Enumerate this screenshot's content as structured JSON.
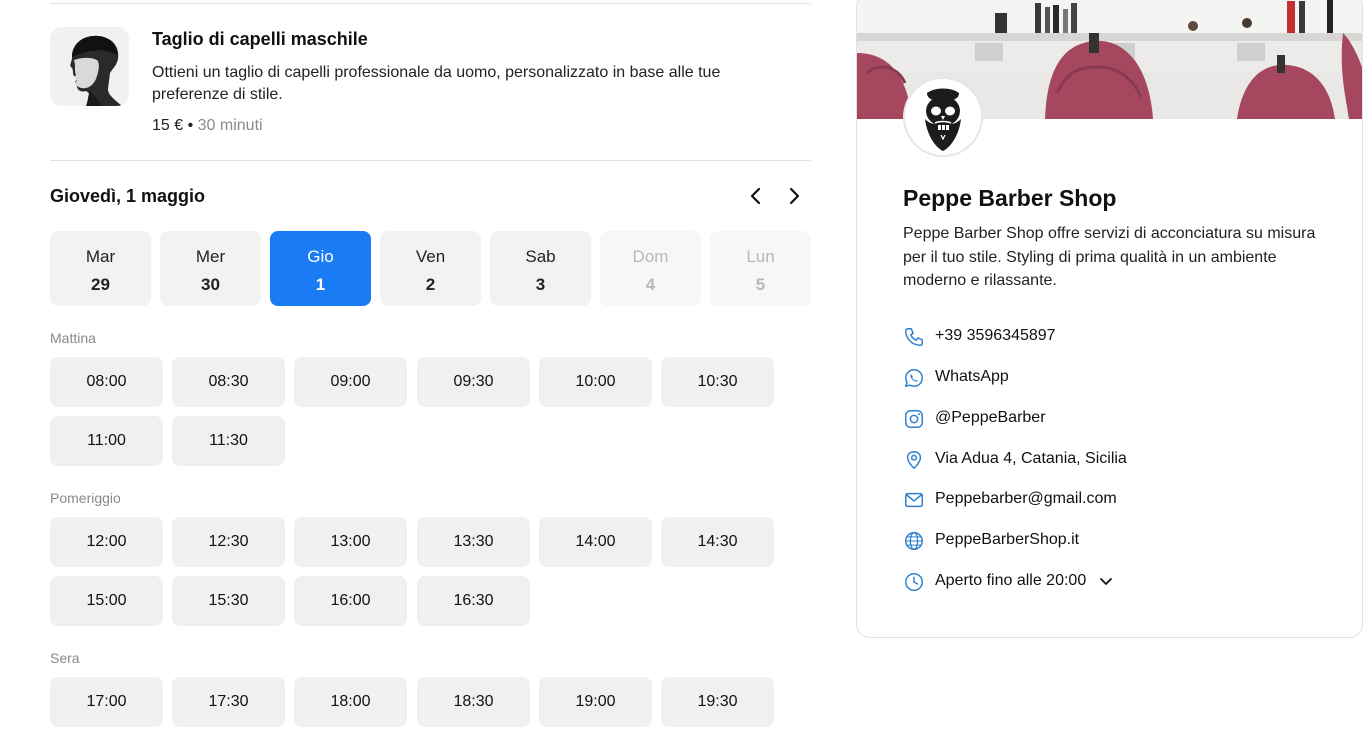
{
  "service": {
    "title": "Taglio di capelli maschile",
    "description": "Ottieni un taglio di capelli professionale da uomo, personalizzato in base alle tue preferenze di stile.",
    "price": "15 €",
    "separator": " • ",
    "duration": "30 minuti"
  },
  "calendar": {
    "selected_date_label": "Giovedì, 1 maggio",
    "days": [
      {
        "name": "Mar",
        "num": "29",
        "state": "available"
      },
      {
        "name": "Mer",
        "num": "30",
        "state": "available"
      },
      {
        "name": "Gio",
        "num": "1",
        "state": "selected"
      },
      {
        "name": "Ven",
        "num": "2",
        "state": "available"
      },
      {
        "name": "Sab",
        "num": "3",
        "state": "available"
      },
      {
        "name": "Dom",
        "num": "4",
        "state": "disabled"
      },
      {
        "name": "Lun",
        "num": "5",
        "state": "disabled"
      }
    ]
  },
  "slots": {
    "morning_label": "Mattina",
    "morning": [
      "08:00",
      "08:30",
      "09:00",
      "09:30",
      "10:00",
      "10:30",
      "11:00",
      "11:30"
    ],
    "afternoon_label": "Pomeriggio",
    "afternoon": [
      "12:00",
      "12:30",
      "13:00",
      "13:30",
      "14:00",
      "14:30",
      "15:00",
      "15:30",
      "16:00",
      "16:30"
    ],
    "evening_label": "Sera",
    "evening": [
      "17:00",
      "17:30",
      "18:00",
      "18:30",
      "19:00",
      "19:30"
    ]
  },
  "shop": {
    "name": "Peppe Barber Shop",
    "description": "Peppe Barber Shop offre servizi di acconciatura su misura per il tuo stile. Styling di prima qualità in un ambiente moderno e rilassante.",
    "phone": "+39 3596345897",
    "whatsapp": "WhatsApp",
    "instagram": "@PeppeBarber",
    "address": "Via Adua 4, Catania, Sicilia",
    "email": "Peppebarber@gmail.com",
    "website": "PeppeBarberShop.it",
    "hours": "Aperto fino alle 20:00"
  },
  "colors": {
    "accent": "#1a7cf5",
    "icon_blue": "#2f7fd1",
    "chair": "#a5485f"
  },
  "icons": [
    "chevron-left-icon",
    "chevron-right-icon",
    "phone-icon",
    "whatsapp-icon",
    "instagram-icon",
    "location-pin-icon",
    "mail-icon",
    "globe-icon",
    "clock-icon",
    "chevron-down-icon"
  ]
}
